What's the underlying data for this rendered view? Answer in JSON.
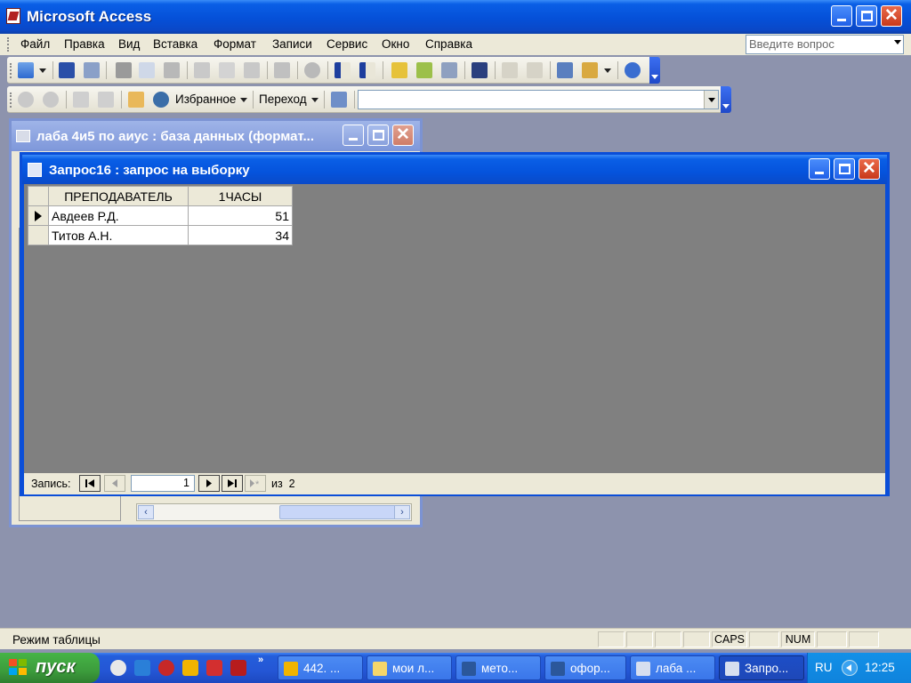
{
  "app": {
    "title": "Microsoft Access"
  },
  "menu": {
    "items": [
      "Файл",
      "Правка",
      "Вид",
      "Вставка",
      "Формат",
      "Записи",
      "Сервис",
      "Окно",
      "Справка"
    ],
    "ask_placeholder": "Введите вопрос"
  },
  "toolbar2": {
    "favorites_label": "Избранное",
    "goto_label": "Переход"
  },
  "db_window": {
    "title": "лаба 4и5 по аиус : база данных (формат..."
  },
  "query_window": {
    "title": "Запрос16 : запрос на выборку",
    "columns": [
      "ПРЕПОДАВАТЕЛЬ",
      "1ЧАСЫ"
    ],
    "rows": [
      {
        "name": "Авдеев Р.Д.",
        "hours": "51"
      },
      {
        "name": "Титов А.Н.",
        "hours": "34"
      }
    ],
    "nav": {
      "record_label": "Запись:",
      "current": "1",
      "of_label": "из",
      "total": "2"
    }
  },
  "status": {
    "message": "Режим таблицы",
    "caps": "CAPS",
    "num": "NUM"
  },
  "taskbar": {
    "start_label": "пуск",
    "tasks": [
      "442. ...",
      "мои л...",
      "мето...",
      "офор...",
      "лаба ...",
      "Запро..."
    ],
    "lang": "RU",
    "clock": "12:25"
  },
  "colors": {
    "xp_blue": "#0a5fe6",
    "inactive_blue": "#7e97da",
    "start_green": "#3c9c3c",
    "mdi_bg": "#8d93ad"
  }
}
